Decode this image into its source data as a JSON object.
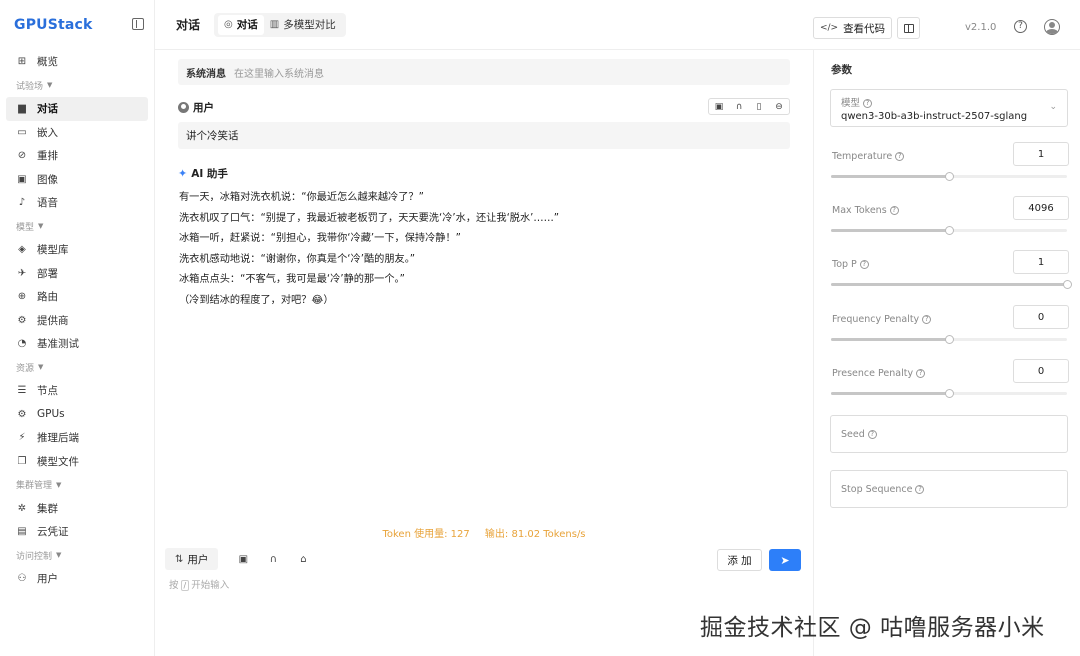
{
  "brand": {
    "logo": "GPUStack"
  },
  "sidebar": {
    "items": [
      {
        "type": "item",
        "label": "概览",
        "icon": "dashboard-icon",
        "glyph": "⊞"
      },
      {
        "type": "group",
        "label": "试验场"
      },
      {
        "type": "item",
        "label": "对话",
        "icon": "chat-icon",
        "glyph": "▆",
        "active": true
      },
      {
        "type": "item",
        "label": "嵌入",
        "icon": "embedding-icon",
        "glyph": "▭"
      },
      {
        "type": "item",
        "label": "重排",
        "icon": "rerank-icon",
        "glyph": "⊘"
      },
      {
        "type": "item",
        "label": "图像",
        "icon": "image-icon",
        "glyph": "▣"
      },
      {
        "type": "item",
        "label": "语音",
        "icon": "speech-icon",
        "glyph": "♪"
      },
      {
        "type": "group",
        "label": "模型"
      },
      {
        "type": "item",
        "label": "模型库",
        "icon": "model-library-icon",
        "glyph": "◈"
      },
      {
        "type": "item",
        "label": "部署",
        "icon": "deploy-icon",
        "glyph": "✈"
      },
      {
        "type": "item",
        "label": "路由",
        "icon": "route-icon",
        "glyph": "⊕"
      },
      {
        "type": "item",
        "label": "提供商",
        "icon": "provider-icon",
        "glyph": "⚙"
      },
      {
        "type": "item",
        "label": "基准测试",
        "icon": "benchmark-icon",
        "glyph": "◔"
      },
      {
        "type": "group",
        "label": "资源"
      },
      {
        "type": "item",
        "label": "节点",
        "icon": "node-icon",
        "glyph": "☰"
      },
      {
        "type": "item",
        "label": "GPUs",
        "icon": "gpu-icon",
        "glyph": "⚙"
      },
      {
        "type": "item",
        "label": "推理后端",
        "icon": "inference-backend-icon",
        "glyph": "⚡"
      },
      {
        "type": "item",
        "label": "模型文件",
        "icon": "model-file-icon",
        "glyph": "❐"
      },
      {
        "type": "group",
        "label": "集群管理"
      },
      {
        "type": "item",
        "label": "集群",
        "icon": "cluster-icon",
        "glyph": "✲"
      },
      {
        "type": "item",
        "label": "云凭证",
        "icon": "cloud-credential-icon",
        "glyph": "▤"
      },
      {
        "type": "group",
        "label": "访问控制"
      },
      {
        "type": "item",
        "label": "用户",
        "icon": "user-icon",
        "glyph": "⚇"
      }
    ]
  },
  "header": {
    "title": "对话",
    "tabs": [
      {
        "label": "对话",
        "glyph": "◎",
        "active": true
      },
      {
        "label": "多模型对比",
        "glyph": "▥",
        "active": false
      }
    ],
    "view_code": "查看代码",
    "version": "v2.1.0"
  },
  "chat": {
    "system_label": "系统消息",
    "system_placeholder": "在这里输入系统消息",
    "user_role": "用户",
    "user_message": "讲个冷笑话",
    "assistant_role": "AI 助手",
    "assistant_lines": [
      "有一天，冰箱对洗衣机说：“你最近怎么越来越冷了？”",
      "洗衣机叹了口气：“别提了，我最近被老板罚了，天天要洗‘冷’水，还让我‘脱水’……”",
      "冰箱一听，赶紧说：“别担心，我带你‘冷藏’一下，保持冷静！”",
      "洗衣机感动地说：“谢谢你，你真是个‘冷’酷的朋友。”",
      "冰箱点点头：“不客气，我可是最‘冷’静的那一个。”",
      "（冷到结冰的程度了，对吧？😂）"
    ],
    "token_usage": "Token 使用量: 127",
    "token_speed": "输出: 81.02 Tokens/s"
  },
  "input": {
    "role_label": "用户",
    "add_label": "添 加",
    "placeholder_pre": "按",
    "placeholder_key": "/",
    "placeholder_post": "开始输入"
  },
  "params": {
    "title": "参数",
    "model_label": "模型",
    "model_value": "qwen3-30b-a3b-instruct-2507-sglang",
    "items": [
      {
        "label": "Temperature",
        "value": "1",
        "fraction": 0.5
      },
      {
        "label": "Max Tokens",
        "value": "4096",
        "fraction": 0.5
      },
      {
        "label": "Top P",
        "value": "1",
        "fraction": 1.0
      },
      {
        "label": "Frequency Penalty",
        "value": "0",
        "fraction": 0.5
      },
      {
        "label": "Presence Penalty",
        "value": "0",
        "fraction": 0.5
      }
    ],
    "seed_label": "Seed",
    "stop_label": "Stop Sequence"
  },
  "watermark": "掘金技术社区 @ 咕噜服务器小米"
}
